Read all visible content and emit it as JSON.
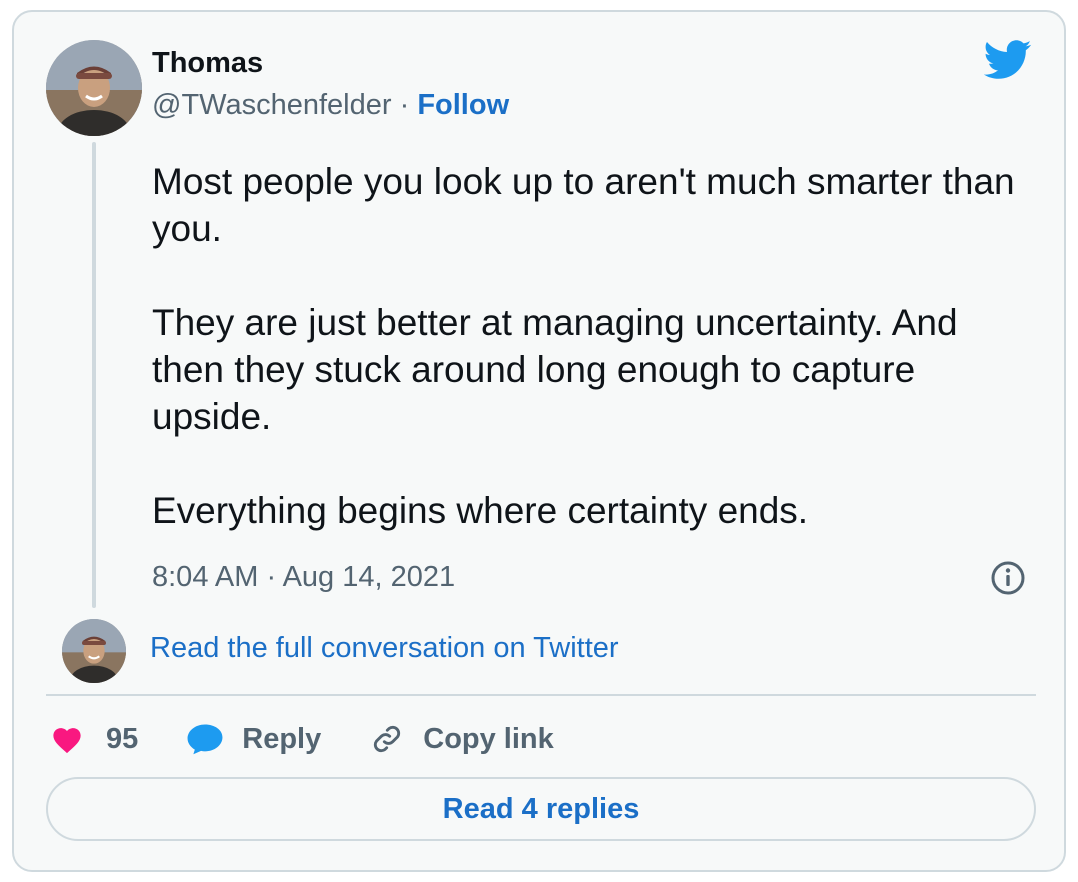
{
  "author": {
    "name": "Thomas",
    "handle": "@TWaschenfelder",
    "separator": "·",
    "follow_label": "Follow",
    "avatar_icon": "user-avatar"
  },
  "brand": {
    "icon": "twitter-bird-icon",
    "color": "#1d9bf0"
  },
  "tweet": {
    "paragraphs": [
      "Most people you look up to aren't much smarter than you.",
      "They are just better at managing uncertainty. And then they stuck around long enough to capture upside.",
      "Everything begins where certainty ends."
    ],
    "timestamp": "8:04 AM · Aug 14, 2021"
  },
  "conversation": {
    "link_label": "Read the full conversation on Twitter"
  },
  "actions": {
    "like_count": "95",
    "like_color": "#f91880",
    "reply_label": "Reply",
    "reply_color": "#1d9bf0",
    "copy_label": "Copy link"
  },
  "replies": {
    "button_label": "Read 4 replies"
  },
  "colors": {
    "link": "#1b6fc7",
    "secondary_text": "#536471",
    "border": "#cfd9de",
    "card_bg": "#f7f9f9"
  }
}
